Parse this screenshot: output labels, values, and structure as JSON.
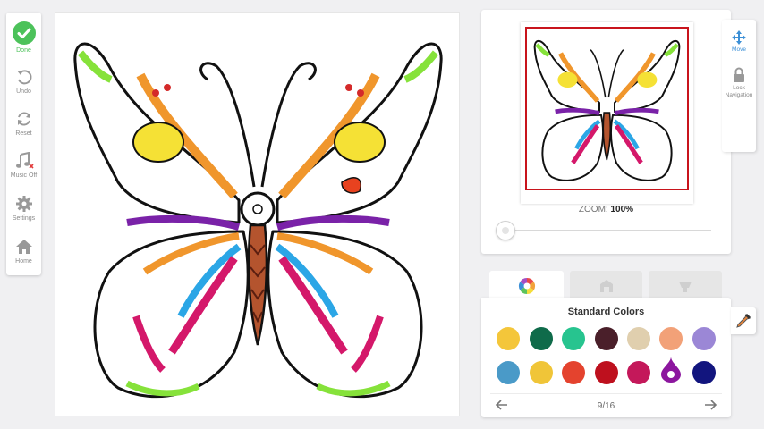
{
  "toolbar": {
    "done": "Done",
    "undo": "Undo",
    "reset": "Reset",
    "music": "Music Off",
    "settings": "Settings",
    "home": "Home"
  },
  "canvas": {
    "subject": "butterfly-coloring-page"
  },
  "preview": {
    "zoom_label": "ZOOM:",
    "zoom_value": "100%"
  },
  "navigation": {
    "move": "Move",
    "lock_line1": "Lock",
    "lock_line2": "Navigation"
  },
  "tabs": [
    {
      "name": "palette",
      "icon": "color-wheel-icon",
      "active": true
    },
    {
      "name": "textures",
      "icon": "texture-icon",
      "active": false
    },
    {
      "name": "fill",
      "icon": "bucket-icon",
      "active": false
    }
  ],
  "palette": {
    "title": "Standard Colors",
    "page": "9/16",
    "colors": [
      "#f4c63a",
      "#0f6b4a",
      "#27c48f",
      "#4a1f2a",
      "#e0cfae",
      "#f2a178",
      "#9b87d6",
      "#4a9ac8",
      "#f0c538",
      "#e4432e",
      "#be101e",
      "#c4185a",
      "#8c169e",
      "#12157e"
    ],
    "selected_index": 12
  },
  "accent": {
    "done_green": "#4cc25a",
    "move_blue": "#3b8fd6",
    "frame_red": "#c8141c"
  }
}
